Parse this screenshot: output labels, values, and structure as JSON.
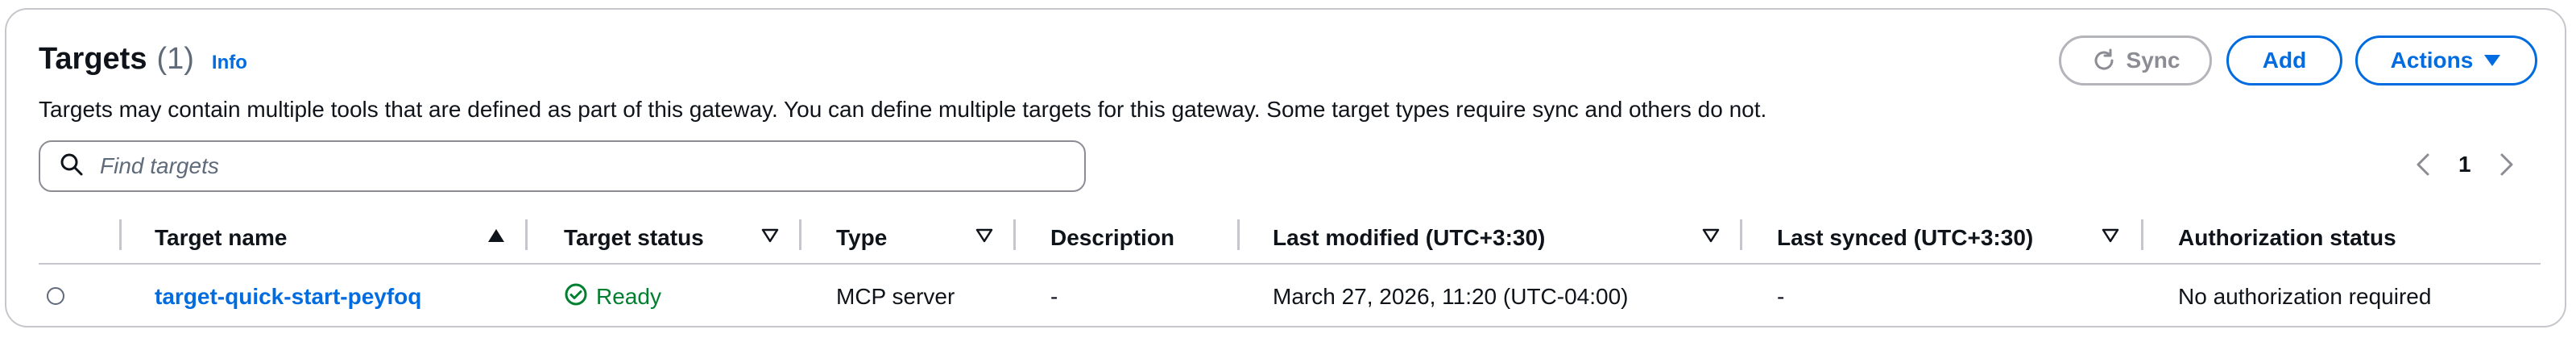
{
  "header": {
    "title": "Targets",
    "count": "(1)",
    "info_label": "Info",
    "description": "Targets may contain multiple tools that are defined as part of this gateway. You can define multiple targets for this gateway. Some target types require sync and others do not."
  },
  "toolbar": {
    "sync_label": "Sync",
    "add_label": "Add",
    "actions_label": "Actions"
  },
  "search": {
    "placeholder": "Find targets",
    "value": ""
  },
  "pagination": {
    "current_page": "1"
  },
  "table": {
    "columns": [
      "Target name",
      "Target status",
      "Type",
      "Description",
      "Last modified (UTC+3:30)",
      "Last synced (UTC+3:30)",
      "Authorization status"
    ],
    "rows": [
      {
        "target_name": "target-quick-start-peyfoq",
        "target_status": "Ready",
        "type": "MCP server",
        "description": "-",
        "last_modified": "March 27, 2026, 11:20 (UTC-04:00)",
        "last_synced": "-",
        "authorization_status": "No authorization required"
      }
    ]
  },
  "colors": {
    "accent": "#006ce0",
    "success": "#00802f",
    "border": "#c6c6cd",
    "disabled": "#8c8c94"
  },
  "icons": [
    "info-link",
    "sync-icon",
    "caret-down-icon",
    "search-icon",
    "chevron-left-icon",
    "chevron-right-icon",
    "sort-ascending-icon",
    "sort-icon",
    "check-circle-icon",
    "radio-button"
  ]
}
